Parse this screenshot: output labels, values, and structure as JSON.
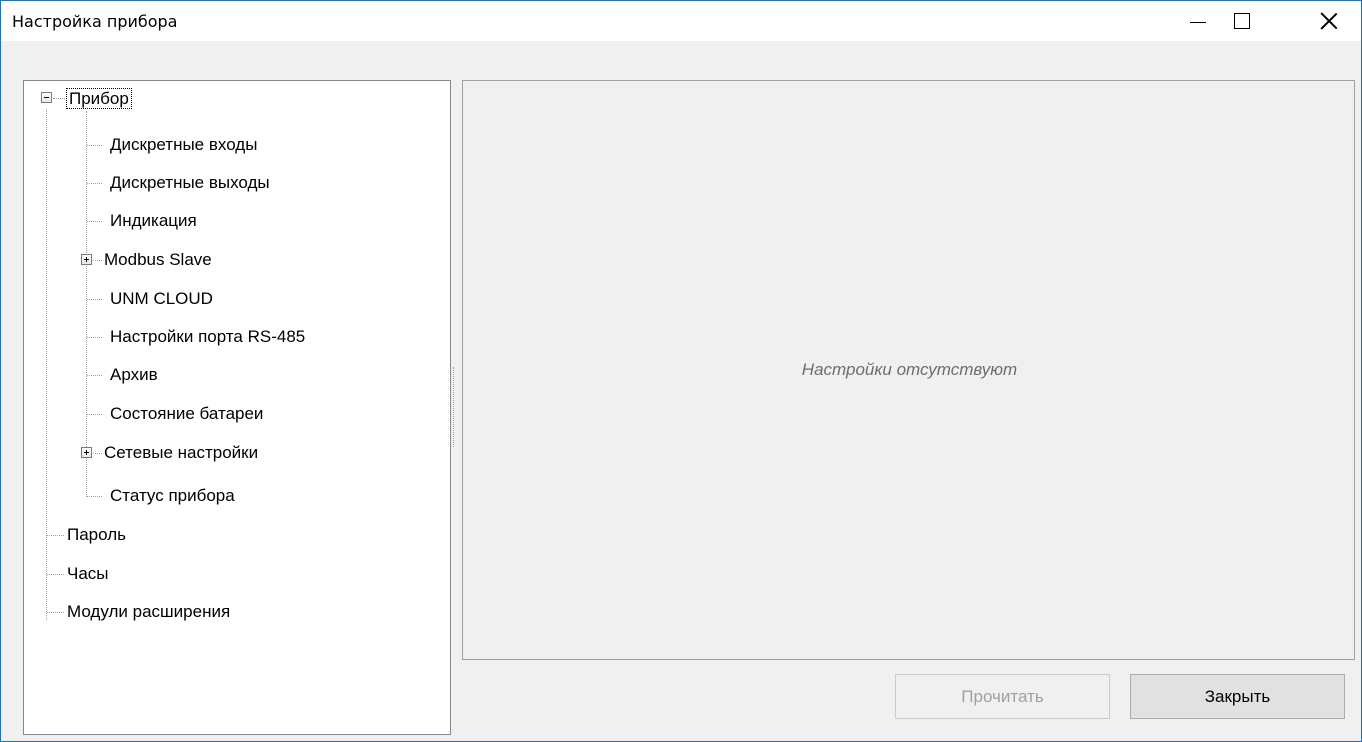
{
  "window": {
    "title": "Настройка прибора"
  },
  "tree": {
    "root": "Прибор",
    "children": [
      "Дискретные входы",
      "Дискретные выходы",
      "Индикация",
      "Modbus Slave",
      "UNM CLOUD",
      "Настройки порта RS-485",
      "Архив",
      "Состояние батареи",
      "Сетевые настройки",
      "Статус прибора"
    ],
    "top_level": [
      "Пароль",
      "Часы",
      "Модули расширения"
    ]
  },
  "panel": {
    "empty_message": "Настройки отсутствуют"
  },
  "buttons": {
    "read": "Прочитать",
    "close": "Закрыть"
  }
}
